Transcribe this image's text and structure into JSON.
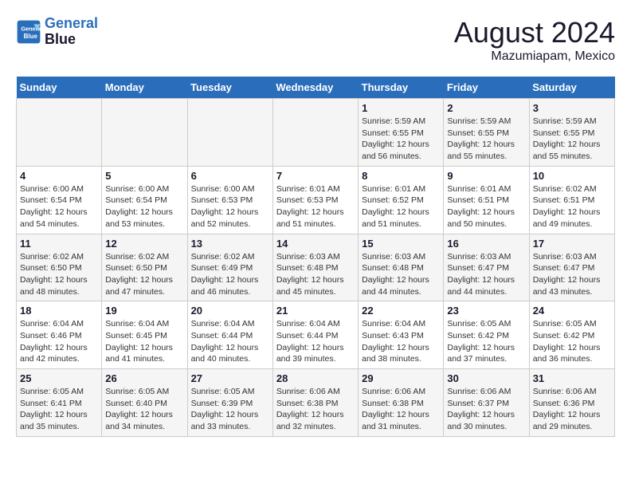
{
  "logo": {
    "line1": "General",
    "line2": "Blue"
  },
  "title": "August 2024",
  "subtitle": "Mazumiapam, Mexico",
  "days_of_week": [
    "Sunday",
    "Monday",
    "Tuesday",
    "Wednesday",
    "Thursday",
    "Friday",
    "Saturday"
  ],
  "weeks": [
    [
      {
        "num": "",
        "info": ""
      },
      {
        "num": "",
        "info": ""
      },
      {
        "num": "",
        "info": ""
      },
      {
        "num": "",
        "info": ""
      },
      {
        "num": "1",
        "info": "Sunrise: 5:59 AM\nSunset: 6:55 PM\nDaylight: 12 hours and 56 minutes."
      },
      {
        "num": "2",
        "info": "Sunrise: 5:59 AM\nSunset: 6:55 PM\nDaylight: 12 hours and 55 minutes."
      },
      {
        "num": "3",
        "info": "Sunrise: 5:59 AM\nSunset: 6:55 PM\nDaylight: 12 hours and 55 minutes."
      }
    ],
    [
      {
        "num": "4",
        "info": "Sunrise: 6:00 AM\nSunset: 6:54 PM\nDaylight: 12 hours and 54 minutes."
      },
      {
        "num": "5",
        "info": "Sunrise: 6:00 AM\nSunset: 6:54 PM\nDaylight: 12 hours and 53 minutes."
      },
      {
        "num": "6",
        "info": "Sunrise: 6:00 AM\nSunset: 6:53 PM\nDaylight: 12 hours and 52 minutes."
      },
      {
        "num": "7",
        "info": "Sunrise: 6:01 AM\nSunset: 6:53 PM\nDaylight: 12 hours and 51 minutes."
      },
      {
        "num": "8",
        "info": "Sunrise: 6:01 AM\nSunset: 6:52 PM\nDaylight: 12 hours and 51 minutes."
      },
      {
        "num": "9",
        "info": "Sunrise: 6:01 AM\nSunset: 6:51 PM\nDaylight: 12 hours and 50 minutes."
      },
      {
        "num": "10",
        "info": "Sunrise: 6:02 AM\nSunset: 6:51 PM\nDaylight: 12 hours and 49 minutes."
      }
    ],
    [
      {
        "num": "11",
        "info": "Sunrise: 6:02 AM\nSunset: 6:50 PM\nDaylight: 12 hours and 48 minutes."
      },
      {
        "num": "12",
        "info": "Sunrise: 6:02 AM\nSunset: 6:50 PM\nDaylight: 12 hours and 47 minutes."
      },
      {
        "num": "13",
        "info": "Sunrise: 6:02 AM\nSunset: 6:49 PM\nDaylight: 12 hours and 46 minutes."
      },
      {
        "num": "14",
        "info": "Sunrise: 6:03 AM\nSunset: 6:48 PM\nDaylight: 12 hours and 45 minutes."
      },
      {
        "num": "15",
        "info": "Sunrise: 6:03 AM\nSunset: 6:48 PM\nDaylight: 12 hours and 44 minutes."
      },
      {
        "num": "16",
        "info": "Sunrise: 6:03 AM\nSunset: 6:47 PM\nDaylight: 12 hours and 44 minutes."
      },
      {
        "num": "17",
        "info": "Sunrise: 6:03 AM\nSunset: 6:47 PM\nDaylight: 12 hours and 43 minutes."
      }
    ],
    [
      {
        "num": "18",
        "info": "Sunrise: 6:04 AM\nSunset: 6:46 PM\nDaylight: 12 hours and 42 minutes."
      },
      {
        "num": "19",
        "info": "Sunrise: 6:04 AM\nSunset: 6:45 PM\nDaylight: 12 hours and 41 minutes."
      },
      {
        "num": "20",
        "info": "Sunrise: 6:04 AM\nSunset: 6:44 PM\nDaylight: 12 hours and 40 minutes."
      },
      {
        "num": "21",
        "info": "Sunrise: 6:04 AM\nSunset: 6:44 PM\nDaylight: 12 hours and 39 minutes."
      },
      {
        "num": "22",
        "info": "Sunrise: 6:04 AM\nSunset: 6:43 PM\nDaylight: 12 hours and 38 minutes."
      },
      {
        "num": "23",
        "info": "Sunrise: 6:05 AM\nSunset: 6:42 PM\nDaylight: 12 hours and 37 minutes."
      },
      {
        "num": "24",
        "info": "Sunrise: 6:05 AM\nSunset: 6:42 PM\nDaylight: 12 hours and 36 minutes."
      }
    ],
    [
      {
        "num": "25",
        "info": "Sunrise: 6:05 AM\nSunset: 6:41 PM\nDaylight: 12 hours and 35 minutes."
      },
      {
        "num": "26",
        "info": "Sunrise: 6:05 AM\nSunset: 6:40 PM\nDaylight: 12 hours and 34 minutes."
      },
      {
        "num": "27",
        "info": "Sunrise: 6:05 AM\nSunset: 6:39 PM\nDaylight: 12 hours and 33 minutes."
      },
      {
        "num": "28",
        "info": "Sunrise: 6:06 AM\nSunset: 6:38 PM\nDaylight: 12 hours and 32 minutes."
      },
      {
        "num": "29",
        "info": "Sunrise: 6:06 AM\nSunset: 6:38 PM\nDaylight: 12 hours and 31 minutes."
      },
      {
        "num": "30",
        "info": "Sunrise: 6:06 AM\nSunset: 6:37 PM\nDaylight: 12 hours and 30 minutes."
      },
      {
        "num": "31",
        "info": "Sunrise: 6:06 AM\nSunset: 6:36 PM\nDaylight: 12 hours and 29 minutes."
      }
    ]
  ]
}
